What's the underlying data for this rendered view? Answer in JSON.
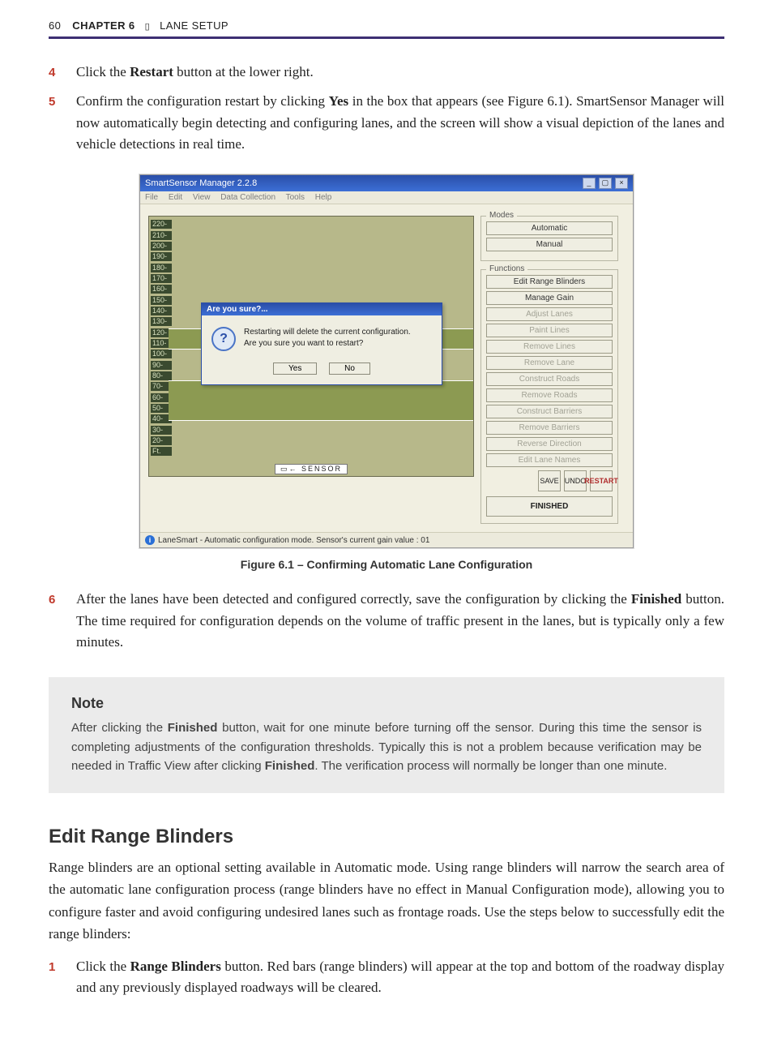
{
  "header": {
    "page_number": "60",
    "chapter_label": "CHAPTER 6",
    "chapter_title": "LANE SETUP"
  },
  "steps_top": [
    {
      "num": "4",
      "pre": "Click the ",
      "bold1": "Restart",
      "post1": " button at the lower right."
    },
    {
      "num": "5",
      "pre": "Confirm the configuration restart by clicking ",
      "bold1": "Yes",
      "post1": " in the box that appears (see Figure 6.1). SmartSensor Manager will now automatically begin detecting and configuring lanes, and the screen will show a visual depiction of the lanes and vehicle detections in real time."
    }
  ],
  "figure": {
    "caption": "Figure 6.1 – Confirming Automatic Lane Configuration",
    "window_title": "SmartSensor Manager 2.2.8",
    "menubar": [
      "File",
      "Edit",
      "View",
      "Data Collection",
      "Tools",
      "Help"
    ],
    "chart_ticks": [
      "220-",
      "210-",
      "200-",
      "190-",
      "180-",
      "170-",
      "160-",
      "150-",
      "140-",
      "130-",
      "120-",
      "110-",
      "100-",
      "90-",
      "80-",
      "70-",
      "60-",
      "50-",
      "40-",
      "30-",
      "20-",
      "Ft."
    ],
    "sensor_label": "SENSOR",
    "dialog": {
      "title": "Are you sure?...",
      "line1": "Restarting will delete the current configuration.",
      "line2": "Are you sure you want to restart?",
      "yes": "Yes",
      "no": "No"
    },
    "modes": {
      "title": "Modes",
      "automatic": "Automatic",
      "manual": "Manual"
    },
    "functions": {
      "title": "Functions",
      "items": [
        {
          "label": "Edit Range Blinders",
          "disabled": false
        },
        {
          "label": "Manage Gain",
          "disabled": false
        },
        {
          "label": "Adjust Lanes",
          "disabled": true
        },
        {
          "label": "Paint Lines",
          "disabled": true
        },
        {
          "label": "Remove Lines",
          "disabled": true
        },
        {
          "label": "Remove Lane",
          "disabled": true
        },
        {
          "label": "Construct Roads",
          "disabled": true
        },
        {
          "label": "Remove Roads",
          "disabled": true
        },
        {
          "label": "Construct Barriers",
          "disabled": true
        },
        {
          "label": "Remove Barriers",
          "disabled": true
        },
        {
          "label": "Reverse Direction",
          "disabled": true
        },
        {
          "label": "Edit Lane Names",
          "disabled": true
        }
      ]
    },
    "iconrow": [
      "SAVE",
      "UNDO",
      "RESTART"
    ],
    "finished": "FINISHED",
    "status": "LaneSmart - Automatic configuration mode.  Sensor's current gain value : 01"
  },
  "steps_mid": [
    {
      "num": "6",
      "pre": "After the lanes have been detected and configured correctly, save the configuration by clicking the ",
      "bold1": "Finished",
      "post1": " button. The time required for configuration depends on the volume of traffic present in the lanes, but is typically only a few minutes."
    }
  ],
  "note": {
    "title": "Note",
    "p1a": "After clicking the ",
    "p1b": "Finished",
    "p1c": " button, wait for one minute before turning off the sensor. During this time the sensor is completing adjustments of the configuration thresholds. Typically this is not a problem because verification may be needed in Traffic View after clicking ",
    "p1d": "Finished",
    "p1e": ". The verification process will normally be longer than one minute."
  },
  "section": {
    "title": "Edit Range Blinders",
    "para": "Range blinders are an optional setting available in Automatic mode. Using range blinders will narrow the search area of the automatic lane configuration process (range blinders have no effect in Manual Configuration mode), allowing you to configure faster and avoid configuring undesired lanes such as frontage roads. Use the steps below to successfully edit the range blinders:"
  },
  "steps_bottom": [
    {
      "num": "1",
      "pre": "Click the ",
      "bold1": "Range Blinders",
      "post1": " button. Red bars (range blinders) will appear at the top and bottom of the roadway display and any previously displayed roadways will be cleared."
    }
  ]
}
